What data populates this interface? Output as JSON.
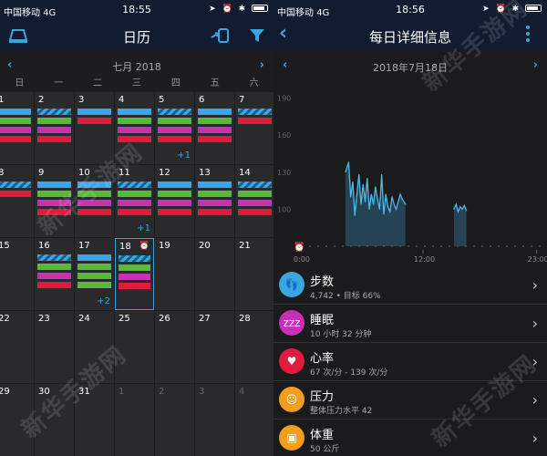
{
  "left": {
    "status": {
      "carrier": "中国移动",
      "network": "4G",
      "time": "18:55"
    },
    "title": "日历",
    "month": "七月 2018",
    "weekdays": [
      "日",
      "一",
      "二",
      "三",
      "四",
      "五",
      "六"
    ],
    "rows": [
      [
        {
          "d": "1",
          "bars": [
            "blue",
            "green",
            "magenta",
            "red"
          ]
        },
        {
          "d": "2",
          "bars": [
            "stripe",
            "green",
            "magenta",
            "red"
          ]
        },
        {
          "d": "3",
          "bars": [
            "blue",
            "red"
          ]
        },
        {
          "d": "4",
          "bars": [
            "blue",
            "green",
            "magenta",
            "red"
          ]
        },
        {
          "d": "5",
          "bars": [
            "stripe",
            "green",
            "magenta",
            "red"
          ],
          "plus": "+1"
        },
        {
          "d": "6",
          "bars": [
            "blue",
            "green",
            "magenta",
            "red"
          ]
        },
        {
          "d": "7",
          "bars": [
            "stripe",
            "red"
          ]
        }
      ],
      [
        {
          "d": "8",
          "bars": [
            "stripe",
            "red"
          ]
        },
        {
          "d": "9",
          "bars": [
            "blue",
            "green",
            "magenta",
            "red"
          ]
        },
        {
          "d": "10",
          "bars": [
            "blue",
            "green",
            "magenta",
            "red"
          ]
        },
        {
          "d": "11",
          "bars": [
            "stripe",
            "green",
            "magenta",
            "red"
          ],
          "plus": "+1"
        },
        {
          "d": "12",
          "bars": [
            "blue",
            "green",
            "magenta",
            "red"
          ]
        },
        {
          "d": "13",
          "bars": [
            "blue",
            "green",
            "magenta",
            "red"
          ]
        },
        {
          "d": "14",
          "bars": [
            "stripe",
            "green",
            "magenta",
            "red"
          ]
        }
      ],
      [
        {
          "d": "15",
          "bars": []
        },
        {
          "d": "16",
          "bars": [
            "stripe",
            "green",
            "magenta",
            "red"
          ]
        },
        {
          "d": "17",
          "bars": [
            "blue",
            "green",
            "green",
            "green"
          ],
          "plus": "+2"
        },
        {
          "d": "18",
          "bars": [
            "stripe",
            "green",
            "magenta",
            "red"
          ],
          "sel": true
        },
        {
          "d": "19",
          "bars": []
        },
        {
          "d": "20",
          "bars": []
        },
        {
          "d": "21",
          "bars": []
        }
      ],
      [
        {
          "d": "22",
          "bars": []
        },
        {
          "d": "23",
          "bars": []
        },
        {
          "d": "24",
          "bars": []
        },
        {
          "d": "25",
          "bars": []
        },
        {
          "d": "26",
          "bars": []
        },
        {
          "d": "27",
          "bars": []
        },
        {
          "d": "28",
          "bars": []
        }
      ],
      [
        {
          "d": "29",
          "bars": []
        },
        {
          "d": "30",
          "bars": []
        },
        {
          "d": "31",
          "bars": []
        },
        {
          "d": "1",
          "bars": [],
          "dim": true
        },
        {
          "d": "2",
          "bars": [],
          "dim": true
        },
        {
          "d": "3",
          "bars": [],
          "dim": true
        },
        {
          "d": "4",
          "bars": [],
          "dim": true
        }
      ]
    ]
  },
  "right": {
    "status": {
      "carrier": "中国移动",
      "network": "4G",
      "time": "18:56"
    },
    "title": "每日详细信息",
    "date": "2018年7月18日",
    "chart_data": {
      "type": "line",
      "y_ticks": [
        "190",
        "160",
        "130",
        "100"
      ],
      "x_ticks": [
        "12:00",
        "23:00"
      ],
      "x_start_label": "0:00",
      "ylim": [
        70,
        200
      ],
      "series": [
        {
          "x": [
            4.5,
            4.8,
            5.0,
            5.2,
            5.4,
            5.6,
            5.8,
            6.0,
            6.2,
            6.4,
            6.6,
            6.8,
            7.0,
            7.2,
            7.4,
            7.6,
            7.8,
            8.0,
            8.2,
            8.4,
            8.6,
            8.8,
            9.0,
            9.2,
            9.4,
            9.6,
            9.8,
            10.0,
            10.3
          ],
          "y": [
            130,
            138,
            110,
            122,
            95,
            112,
            128,
            104,
            120,
            106,
            125,
            100,
            112,
            104,
            118,
            108,
            100,
            128,
            96,
            112,
            102,
            98,
            110,
            104,
            100,
            106,
            112,
            108,
            104
          ]
        },
        {
          "x": [
            15.0,
            15.2,
            15.4,
            15.6,
            15.8,
            16.0,
            16.2
          ],
          "y": [
            100,
            104,
            98,
            102,
            100,
            103,
            99
          ]
        }
      ]
    },
    "items": [
      {
        "title": "步数",
        "sub": "4,742 • 目标 66%",
        "color": "#3aa8e0",
        "icon": "steps-icon",
        "glyph": "👣"
      },
      {
        "title": "睡眠",
        "sub": "10 小时 32 分钟",
        "color": "#c830b8",
        "icon": "sleep-icon",
        "glyph": "zzz"
      },
      {
        "title": "心率",
        "sub": "67 次/分 - 139 次/分",
        "color": "#e01c3c",
        "icon": "heart-icon",
        "glyph": "♥"
      },
      {
        "title": "压力",
        "sub": "整体压力水平 42",
        "color": "#f39c1e",
        "icon": "stress-icon",
        "glyph": "☺"
      },
      {
        "title": "体重",
        "sub": "50 公斤",
        "color": "#f39c1e",
        "icon": "weight-icon",
        "glyph": "▣"
      }
    ]
  },
  "watermarks": [
    "新华手游网",
    "新华手游网",
    "新华手游网",
    "新华手游网"
  ]
}
